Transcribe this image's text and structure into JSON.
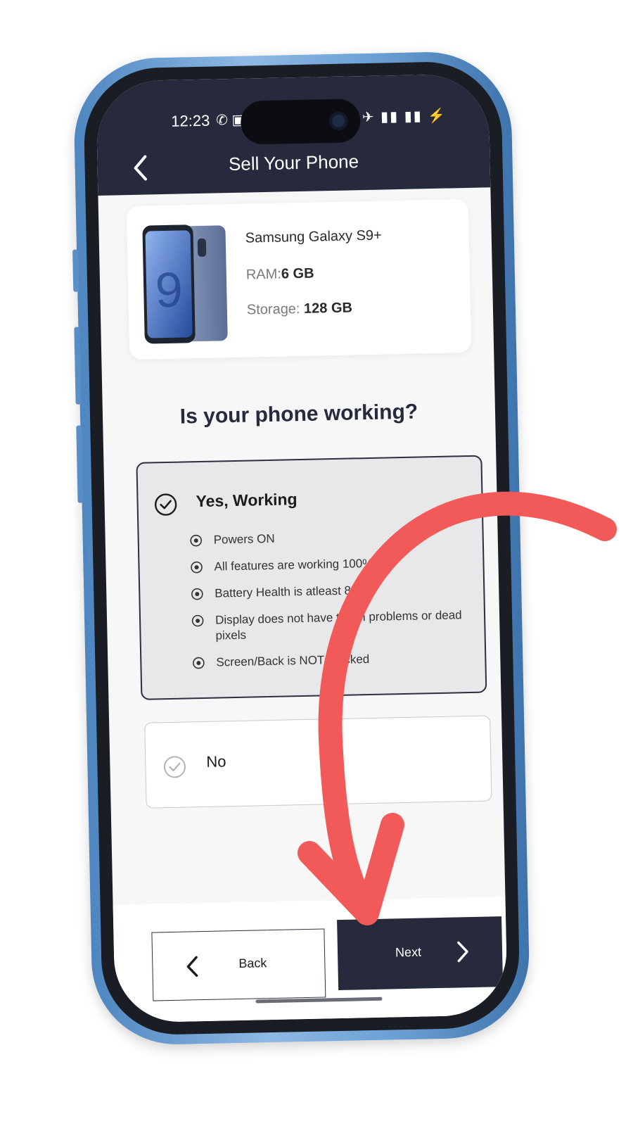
{
  "status_bar": {
    "time": "12:23",
    "left_icons": "✆ ▣",
    "right_icons": "✱ ✈ ▮▮ ▮▮ ⚡"
  },
  "header": {
    "title": "Sell Your Phone"
  },
  "product": {
    "name": "Samsung Galaxy S9+",
    "ram_label": "RAM:",
    "ram_value": "6 GB",
    "storage_label": "Storage: ",
    "storage_value": "128 GB"
  },
  "question": "Is your phone working?",
  "options": {
    "yes": {
      "title": "Yes, Working",
      "selected": true,
      "features": [
        "Powers ON",
        "All features are working 100%",
        "Battery Health is atleast 80%",
        "Display does not have touch problems or dead pixels",
        "Screen/Back is NOT cracked"
      ]
    },
    "no": {
      "title": "No",
      "selected": false
    }
  },
  "footer": {
    "back_label": "Back",
    "next_label": "Next"
  },
  "colors": {
    "header_bg": "#272a3d",
    "phone_frame": "#6a9fd4",
    "annotation_arrow": "#f25a5a",
    "selected_option_bg": "#e8e8ea"
  },
  "icons": {
    "back": "chevron-left-icon",
    "next": "chevron-right-icon",
    "check": "check-circle-icon",
    "bullet": "radio-dot-icon"
  }
}
